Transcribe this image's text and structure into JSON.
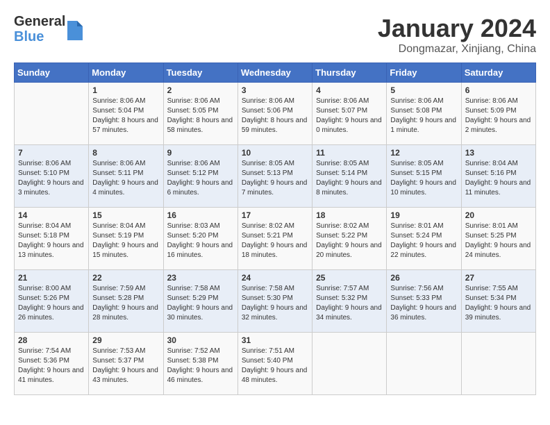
{
  "header": {
    "logo_general": "General",
    "logo_blue": "Blue",
    "month_title": "January 2024",
    "location": "Dongmazar, Xinjiang, China"
  },
  "weekdays": [
    "Sunday",
    "Monday",
    "Tuesday",
    "Wednesday",
    "Thursday",
    "Friday",
    "Saturday"
  ],
  "weeks": [
    [
      {
        "day": "",
        "sunrise": "",
        "sunset": "",
        "daylight": ""
      },
      {
        "day": "1",
        "sunrise": "Sunrise: 8:06 AM",
        "sunset": "Sunset: 5:04 PM",
        "daylight": "Daylight: 8 hours and 57 minutes."
      },
      {
        "day": "2",
        "sunrise": "Sunrise: 8:06 AM",
        "sunset": "Sunset: 5:05 PM",
        "daylight": "Daylight: 8 hours and 58 minutes."
      },
      {
        "day": "3",
        "sunrise": "Sunrise: 8:06 AM",
        "sunset": "Sunset: 5:06 PM",
        "daylight": "Daylight: 8 hours and 59 minutes."
      },
      {
        "day": "4",
        "sunrise": "Sunrise: 8:06 AM",
        "sunset": "Sunset: 5:07 PM",
        "daylight": "Daylight: 9 hours and 0 minutes."
      },
      {
        "day": "5",
        "sunrise": "Sunrise: 8:06 AM",
        "sunset": "Sunset: 5:08 PM",
        "daylight": "Daylight: 9 hours and 1 minute."
      },
      {
        "day": "6",
        "sunrise": "Sunrise: 8:06 AM",
        "sunset": "Sunset: 5:09 PM",
        "daylight": "Daylight: 9 hours and 2 minutes."
      }
    ],
    [
      {
        "day": "7",
        "sunrise": "Sunrise: 8:06 AM",
        "sunset": "Sunset: 5:10 PM",
        "daylight": "Daylight: 9 hours and 3 minutes."
      },
      {
        "day": "8",
        "sunrise": "Sunrise: 8:06 AM",
        "sunset": "Sunset: 5:11 PM",
        "daylight": "Daylight: 9 hours and 4 minutes."
      },
      {
        "day": "9",
        "sunrise": "Sunrise: 8:06 AM",
        "sunset": "Sunset: 5:12 PM",
        "daylight": "Daylight: 9 hours and 6 minutes."
      },
      {
        "day": "10",
        "sunrise": "Sunrise: 8:05 AM",
        "sunset": "Sunset: 5:13 PM",
        "daylight": "Daylight: 9 hours and 7 minutes."
      },
      {
        "day": "11",
        "sunrise": "Sunrise: 8:05 AM",
        "sunset": "Sunset: 5:14 PM",
        "daylight": "Daylight: 9 hours and 8 minutes."
      },
      {
        "day": "12",
        "sunrise": "Sunrise: 8:05 AM",
        "sunset": "Sunset: 5:15 PM",
        "daylight": "Daylight: 9 hours and 10 minutes."
      },
      {
        "day": "13",
        "sunrise": "Sunrise: 8:04 AM",
        "sunset": "Sunset: 5:16 PM",
        "daylight": "Daylight: 9 hours and 11 minutes."
      }
    ],
    [
      {
        "day": "14",
        "sunrise": "Sunrise: 8:04 AM",
        "sunset": "Sunset: 5:18 PM",
        "daylight": "Daylight: 9 hours and 13 minutes."
      },
      {
        "day": "15",
        "sunrise": "Sunrise: 8:04 AM",
        "sunset": "Sunset: 5:19 PM",
        "daylight": "Daylight: 9 hours and 15 minutes."
      },
      {
        "day": "16",
        "sunrise": "Sunrise: 8:03 AM",
        "sunset": "Sunset: 5:20 PM",
        "daylight": "Daylight: 9 hours and 16 minutes."
      },
      {
        "day": "17",
        "sunrise": "Sunrise: 8:02 AM",
        "sunset": "Sunset: 5:21 PM",
        "daylight": "Daylight: 9 hours and 18 minutes."
      },
      {
        "day": "18",
        "sunrise": "Sunrise: 8:02 AM",
        "sunset": "Sunset: 5:22 PM",
        "daylight": "Daylight: 9 hours and 20 minutes."
      },
      {
        "day": "19",
        "sunrise": "Sunrise: 8:01 AM",
        "sunset": "Sunset: 5:24 PM",
        "daylight": "Daylight: 9 hours and 22 minutes."
      },
      {
        "day": "20",
        "sunrise": "Sunrise: 8:01 AM",
        "sunset": "Sunset: 5:25 PM",
        "daylight": "Daylight: 9 hours and 24 minutes."
      }
    ],
    [
      {
        "day": "21",
        "sunrise": "Sunrise: 8:00 AM",
        "sunset": "Sunset: 5:26 PM",
        "daylight": "Daylight: 9 hours and 26 minutes."
      },
      {
        "day": "22",
        "sunrise": "Sunrise: 7:59 AM",
        "sunset": "Sunset: 5:28 PM",
        "daylight": "Daylight: 9 hours and 28 minutes."
      },
      {
        "day": "23",
        "sunrise": "Sunrise: 7:58 AM",
        "sunset": "Sunset: 5:29 PM",
        "daylight": "Daylight: 9 hours and 30 minutes."
      },
      {
        "day": "24",
        "sunrise": "Sunrise: 7:58 AM",
        "sunset": "Sunset: 5:30 PM",
        "daylight": "Daylight: 9 hours and 32 minutes."
      },
      {
        "day": "25",
        "sunrise": "Sunrise: 7:57 AM",
        "sunset": "Sunset: 5:32 PM",
        "daylight": "Daylight: 9 hours and 34 minutes."
      },
      {
        "day": "26",
        "sunrise": "Sunrise: 7:56 AM",
        "sunset": "Sunset: 5:33 PM",
        "daylight": "Daylight: 9 hours and 36 minutes."
      },
      {
        "day": "27",
        "sunrise": "Sunrise: 7:55 AM",
        "sunset": "Sunset: 5:34 PM",
        "daylight": "Daylight: 9 hours and 39 minutes."
      }
    ],
    [
      {
        "day": "28",
        "sunrise": "Sunrise: 7:54 AM",
        "sunset": "Sunset: 5:36 PM",
        "daylight": "Daylight: 9 hours and 41 minutes."
      },
      {
        "day": "29",
        "sunrise": "Sunrise: 7:53 AM",
        "sunset": "Sunset: 5:37 PM",
        "daylight": "Daylight: 9 hours and 43 minutes."
      },
      {
        "day": "30",
        "sunrise": "Sunrise: 7:52 AM",
        "sunset": "Sunset: 5:38 PM",
        "daylight": "Daylight: 9 hours and 46 minutes."
      },
      {
        "day": "31",
        "sunrise": "Sunrise: 7:51 AM",
        "sunset": "Sunset: 5:40 PM",
        "daylight": "Daylight: 9 hours and 48 minutes."
      },
      {
        "day": "",
        "sunrise": "",
        "sunset": "",
        "daylight": ""
      },
      {
        "day": "",
        "sunrise": "",
        "sunset": "",
        "daylight": ""
      },
      {
        "day": "",
        "sunrise": "",
        "sunset": "",
        "daylight": ""
      }
    ]
  ]
}
